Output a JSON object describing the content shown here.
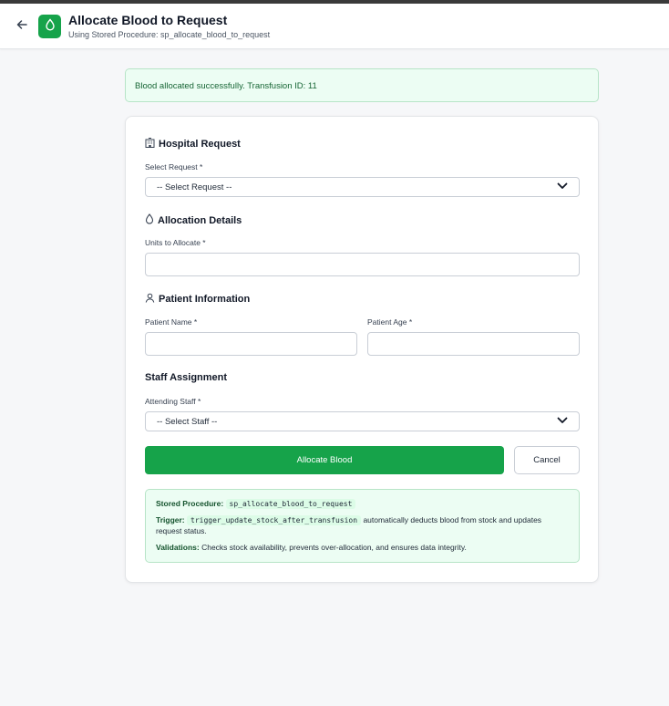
{
  "header": {
    "title": "Allocate Blood to Request",
    "subtitle": "Using Stored Procedure: sp_allocate_blood_to_request",
    "back_icon": "arrow-left-icon",
    "app_icon": "blood-drop-icon",
    "accent_color": "#16a34a"
  },
  "alert": {
    "message": "Blood allocated successfully. Transfusion ID: 11"
  },
  "form": {
    "hospital_section": {
      "title": "Hospital Request",
      "icon": "hospital-icon"
    },
    "request_label": "Select Request *",
    "request_value": "-- Select Request --",
    "allocation_section": {
      "title": "Allocation Details",
      "icon": "blood-drop-icon"
    },
    "units_label": "Units to Allocate *",
    "units_value": "",
    "patient_section": {
      "title": "Patient Information",
      "icon": "user-icon"
    },
    "patient_name_label": "Patient Name *",
    "patient_name_value": "",
    "patient_age_label": "Patient Age *",
    "patient_age_value": "",
    "staff_section": {
      "title": "Staff Assignment"
    },
    "staff_label": "Attending Staff *",
    "staff_value": "-- Select Staff --",
    "allocate_button": "Allocate Blood",
    "cancel_button": "Cancel"
  },
  "info": {
    "procedure_key": "Stored Procedure:",
    "procedure_name": "sp_allocate_blood_to_request",
    "trigger_key": "Trigger:",
    "trigger_name": "trigger_update_stock_after_transfusion",
    "trigger_desc_1": "automatically deducts blood from stock and updates",
    "trigger_desc_2": "request status.",
    "validations_key": "Validations:",
    "validations_desc": "Checks stock availability, prevents over-allocation, and ensures data integrity."
  }
}
